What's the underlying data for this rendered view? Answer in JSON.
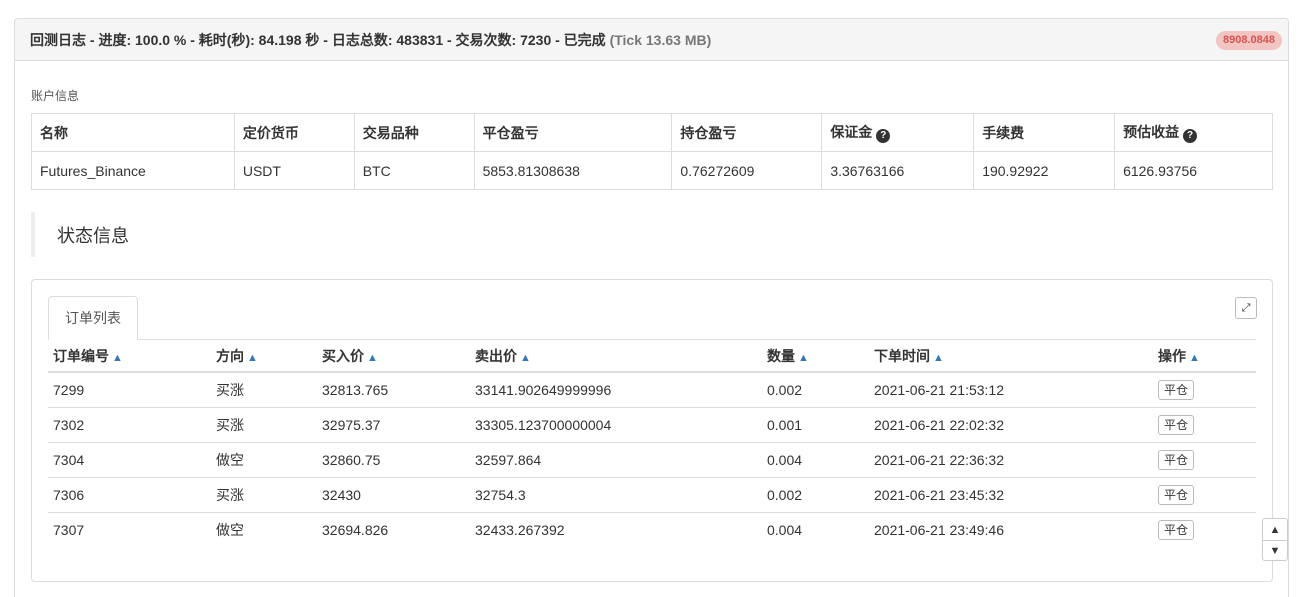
{
  "header": {
    "title": "回测日志 - 进度: 100.0 % - 耗时(秒): 84.198 秒 - 日志总数: 483831 - 交易次数: 7230 - 已完成",
    "tick": "(Tick 13.63 MB)",
    "badge": "8908.0848"
  },
  "account": {
    "section_label": "账户信息",
    "columns": [
      "名称",
      "定价货币",
      "交易品种",
      "平仓盈亏",
      "持仓盈亏",
      "保证金",
      "手续费",
      "预估收益"
    ],
    "row": [
      "Futures_Binance",
      "USDT",
      "BTC",
      "5853.81308638",
      "0.76272609",
      "3.36763166",
      "190.92922",
      "6126.93756"
    ]
  },
  "status": {
    "heading": "状态信息",
    "tab_label": "订单列表",
    "columns": [
      "订单编号",
      "方向",
      "买入价",
      "卖出价",
      "数量",
      "下单时间",
      "操作"
    ],
    "rows": [
      [
        "7299",
        "买涨",
        "32813.765",
        "33141.902649999996",
        "0.002",
        "2021-06-21 21:53:12",
        "平仓"
      ],
      [
        "7302",
        "买涨",
        "32975.37",
        "33305.123700000004",
        "0.001",
        "2021-06-21 22:02:32",
        "平仓"
      ],
      [
        "7304",
        "做空",
        "32860.75",
        "32597.864",
        "0.004",
        "2021-06-21 22:36:32",
        "平仓"
      ],
      [
        "7306",
        "买涨",
        "32430",
        "32754.3",
        "0.002",
        "2021-06-21 23:45:32",
        "平仓"
      ],
      [
        "7307",
        "做空",
        "32694.826",
        "32433.267392",
        "0.004",
        "2021-06-21 23:49:46",
        "平仓"
      ]
    ]
  },
  "icons": {
    "help": "question-circle-icon",
    "sort": "sort-icon",
    "expand": "expand-icon",
    "scroll_up": "chevron-up-icon",
    "scroll_down": "chevron-down-icon"
  },
  "colors": {
    "badge_bg": "#f2c4c2",
    "badge_text": "#d9534f",
    "sort_icon": "#337ab7"
  }
}
